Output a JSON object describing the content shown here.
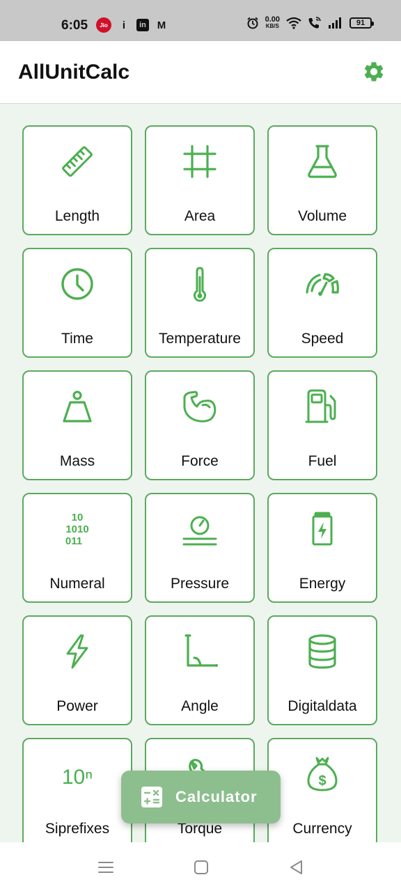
{
  "status_bar": {
    "time": "6:05",
    "carrier_badge": "Jio",
    "info_glyph": "i",
    "linkedin_glyph": "in",
    "gmail_glyph": "M",
    "net_speed_value": "0.00",
    "net_speed_unit": "KB/S",
    "battery_level": "91",
    "icons": [
      "jio-icon",
      "info-icon",
      "linkedin-icon",
      "gmail-icon",
      "alarm-icon",
      "wifi-icon",
      "wifi-call-icon",
      "signal-icon",
      "battery-icon"
    ]
  },
  "appbar": {
    "title": "AllUnitCalc",
    "settings_icon": "gear-icon"
  },
  "categories": [
    {
      "label": "Length",
      "icon": "ruler-icon"
    },
    {
      "label": "Area",
      "icon": "crop-frame-icon"
    },
    {
      "label": "Volume",
      "icon": "flask-icon"
    },
    {
      "label": "Time",
      "icon": "clock-icon"
    },
    {
      "label": "Temperature",
      "icon": "thermometer-icon"
    },
    {
      "label": "Speed",
      "icon": "speedometer-icon"
    },
    {
      "label": "Mass",
      "icon": "weight-icon"
    },
    {
      "label": "Force",
      "icon": "flexed-arm-icon"
    },
    {
      "label": "Fuel",
      "icon": "fuel-pump-icon"
    },
    {
      "label": "Numeral",
      "icon": "binary-icon",
      "icon_text": [
        "10",
        "1010",
        "011"
      ]
    },
    {
      "label": "Pressure",
      "icon": "pressure-gauge-icon"
    },
    {
      "label": "Energy",
      "icon": "battery-charging-icon"
    },
    {
      "label": "Power",
      "icon": "lightning-icon"
    },
    {
      "label": "Angle",
      "icon": "angle-icon"
    },
    {
      "label": "Digitaldata",
      "icon": "database-icon"
    },
    {
      "label": "Siprefixes",
      "icon": "power-of-ten-icon",
      "icon_text": "10ⁿ"
    },
    {
      "label": "Torque",
      "icon": "wrench-icon"
    },
    {
      "label": "Currency",
      "icon": "money-bag-icon",
      "icon_text": "$"
    }
  ],
  "fab": {
    "label": "Calculator",
    "icon": "calculator-icon"
  },
  "nav_bar": {
    "items": [
      "menu-icon",
      "home-square-icon",
      "back-triangle-icon"
    ]
  },
  "colors": {
    "accent": "#4caf50",
    "card_border": "#5ba95e",
    "content_bg": "#eef5ee",
    "fab_bg": "#8dbf8e",
    "status_bar_bg": "#c8c8c8"
  }
}
